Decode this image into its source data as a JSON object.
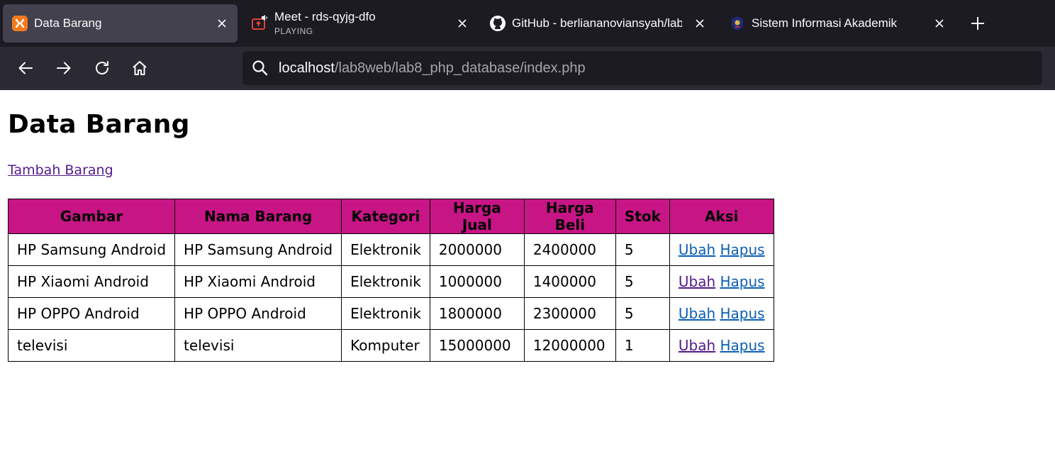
{
  "browser": {
    "tabs": [
      {
        "title": "Data Barang",
        "subtitle": "",
        "icon": "xampp-icon",
        "active": true
      },
      {
        "title": "Meet - rds-qyjg-dfo",
        "subtitle": "PLAYING",
        "icon": "meet-icon",
        "active": false
      },
      {
        "title": "GitHub - berliananoviansyah/lab",
        "subtitle": "",
        "icon": "github-icon",
        "active": false
      },
      {
        "title": "Sistem Informasi Akademik",
        "subtitle": "",
        "icon": "university-logo-icon",
        "active": false
      }
    ],
    "url": {
      "host": "localhost",
      "path": "/lab8web/lab8_php_database/index.php"
    },
    "colors": {
      "tabstrip": "#1c1b22",
      "active_tab": "#42414d",
      "toolbar": "#2b2a33"
    }
  },
  "page": {
    "title": "Data Barang",
    "add_link": "Tambah Barang",
    "table": {
      "header_color": "#c71585",
      "columns": [
        "Gambar",
        "Nama Barang",
        "Kategori",
        "Harga Jual",
        "Harga Beli",
        "Stok",
        "Aksi"
      ],
      "rows": [
        {
          "gambar": "HP Samsung Android",
          "nama": "HP Samsung Android",
          "kategori": "Elektronik",
          "harga_jual": "2000000",
          "harga_beli": "2400000",
          "stok": "5",
          "ubah": "Ubah",
          "hapus": "Hapus"
        },
        {
          "gambar": "HP Xiaomi Android",
          "nama": "HP Xiaomi Android",
          "kategori": "Elektronik",
          "harga_jual": "1000000",
          "harga_beli": "1400000",
          "stok": "5",
          "ubah": "Ubah",
          "hapus": "Hapus"
        },
        {
          "gambar": "HP OPPO Android",
          "nama": "HP OPPO Android",
          "kategori": "Elektronik",
          "harga_jual": "1800000",
          "harga_beli": "2300000",
          "stok": "5",
          "ubah": "Ubah",
          "hapus": "Hapus"
        },
        {
          "gambar": "televisi",
          "nama": "televisi",
          "kategori": "Komputer",
          "harga_jual": "15000000",
          "harga_beli": "12000000",
          "stok": "1",
          "ubah": "Ubah",
          "hapus": "Hapus"
        }
      ]
    }
  }
}
